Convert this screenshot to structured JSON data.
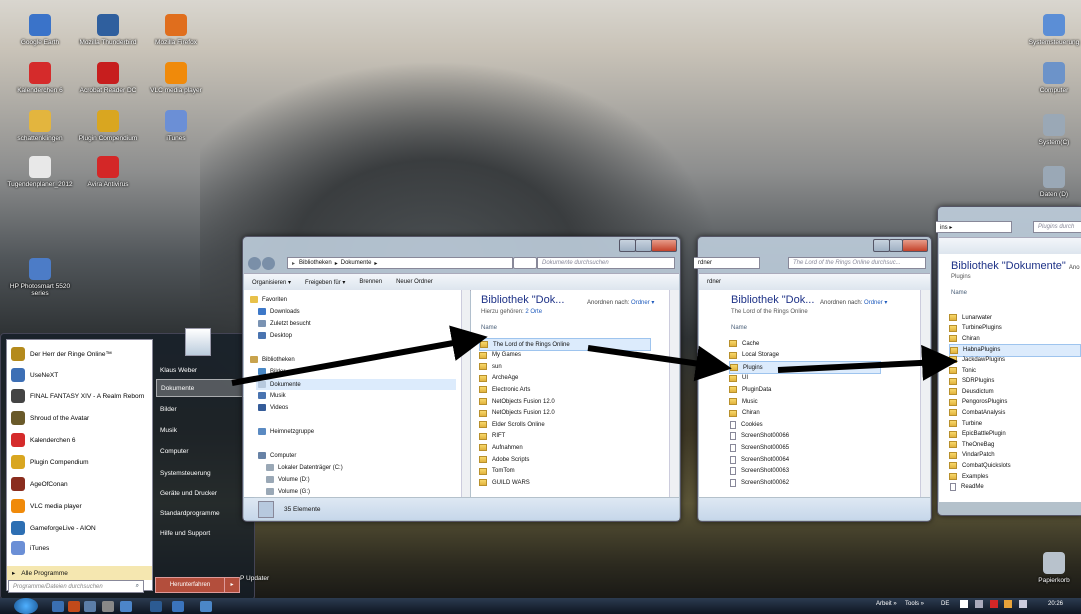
{
  "desktop_icons_left": [
    {
      "label": "Google Earth",
      "icon": "google-earth-icon",
      "color": "#3a73c9"
    },
    {
      "label": "Mozilla Thunderbird",
      "icon": "thunderbird-icon",
      "color": "#2f5f9e"
    },
    {
      "label": "Mozilla Firefox",
      "icon": "firefox-icon",
      "color": "#e06e1d"
    },
    {
      "label": "Kalenderchen 6",
      "icon": "calendar-icon",
      "color": "#d52b2b"
    },
    {
      "label": "Acrobat Reader DC",
      "icon": "acrobat-icon",
      "color": "#c71e1e"
    },
    {
      "label": "VLC media player",
      "icon": "vlc-icon",
      "color": "#f08a0a"
    },
    {
      "label": "schattenklingen",
      "icon": "folder-icon",
      "color": "#e3b53e"
    },
    {
      "label": "Plugin Compendium",
      "icon": "plugin-compendium-icon",
      "color": "#d9a620"
    },
    {
      "label": "iTunes",
      "icon": "itunes-icon",
      "color": "#6b8fd6"
    },
    {
      "label": "Tugendenplaner_2012",
      "icon": "document-icon",
      "color": "#e8e8e8"
    },
    {
      "label": "Avira Antivirus",
      "icon": "avira-icon",
      "color": "#d42727"
    },
    {
      "label": "HP Photosmart 5520 series",
      "icon": "printer-icon",
      "color": "#4c7cc7"
    }
  ],
  "desktop_icons_right": [
    {
      "label": "Systemsteuerung",
      "icon": "control-panel-icon",
      "color": "#5b8ed6"
    },
    {
      "label": "Computer",
      "icon": "computer-icon",
      "color": "#6c93c9"
    },
    {
      "label": "System(C)",
      "icon": "drive-icon",
      "color": "#9aa8b6"
    },
    {
      "label": "Daten (D)",
      "icon": "drive-icon",
      "color": "#9aa8b6"
    },
    {
      "label": "Papierkorb",
      "icon": "recycle-bin-icon",
      "color": "#b8c2cc"
    }
  ],
  "start_menu": {
    "programs": [
      {
        "label": "Der Herr der Ringe Online™",
        "color": "#b48a1c"
      },
      {
        "label": "UseNeXT",
        "color": "#3d6fb5"
      },
      {
        "label": "FINAL FANTASY XIV - A Realm Reborn",
        "color": "#444"
      },
      {
        "label": "Shroud of the Avatar",
        "color": "#6a5a2a"
      },
      {
        "label": "Kalenderchen 6",
        "color": "#d52b2b"
      },
      {
        "label": "Plugin Compendium",
        "color": "#d9a620"
      },
      {
        "label": "AgeOfConan",
        "color": "#8a2d1e"
      },
      {
        "label": "VLC media player",
        "color": "#f08a0a"
      },
      {
        "label": "GameforgeLive - AION",
        "color": "#2d6fb3"
      },
      {
        "label": "iTunes",
        "color": "#6b8fd6"
      }
    ],
    "all_programs": "Alle Programme",
    "search_placeholder": "Programme/Dateien durchsuchen",
    "right_items": [
      "Klaus Weber",
      "Dokumente",
      "Bilder",
      "Musik",
      "Computer",
      "Systemsteuerung",
      "Geräte und Drucker",
      "Standardprogramme",
      "Hilfe und Support"
    ],
    "shutdown": "Herunterfahren",
    "shutdown_arrow": "▸"
  },
  "window1": {
    "address": [
      "Bibliotheken",
      "Dokumente"
    ],
    "search_placeholder": "Dokumente durchsuchen",
    "toolbar": [
      "Organisieren ▾",
      "Freigeben für ▾",
      "Brennen",
      "Neuer Ordner"
    ],
    "nav": {
      "favorites": "Favoriten",
      "fav_items": [
        "Downloads",
        "Zuletzt besucht",
        "Desktop"
      ],
      "libraries": "Bibliotheken",
      "lib_items": [
        "Bilder",
        "Dokumente",
        "Musik",
        "Videos"
      ],
      "homegroup": "Heimnetzgruppe",
      "computer": "Computer",
      "drives": [
        "Lokaler Datenträger (C:)",
        "Volume (D:)",
        "Volume (G:)"
      ]
    },
    "lib_title": "Bibliothek \"Dok...",
    "lib_sub": "Hierzu gehören:",
    "lib_sub_link": "2 Orte",
    "arrange": "Anordnen nach:",
    "arrange_value": "Ordner ▾",
    "col_name": "Name",
    "files": [
      "The Lord of the Rings Online",
      "My Games",
      "sun",
      "ArcheAge",
      "Electronic Arts",
      "NetObjects Fusion 12.0",
      "NetObjects Fusion 12.0",
      "Elder Scrolls Online",
      "RIFT",
      "Aufnahmen",
      "Adobe Scripts",
      "TomTom",
      "GUILD WARS"
    ],
    "status": "35 Elemente"
  },
  "window2": {
    "address_fragment": "rdner",
    "search_placeholder": "The Lord of the Rings Online durchsuc...",
    "lib_title": "Bibliothek \"Dok...",
    "lib_sub": "The Lord of the Rings Online",
    "arrange": "Anordnen nach:",
    "arrange_value": "Ordner ▾",
    "col_name": "Name",
    "files": [
      {
        "name": "Cache",
        "type": "folder"
      },
      {
        "name": "Local Storage",
        "type": "folder"
      },
      {
        "name": "Plugins",
        "type": "folder"
      },
      {
        "name": "UI",
        "type": "folder"
      },
      {
        "name": "PluginData",
        "type": "folder"
      },
      {
        "name": "Music",
        "type": "folder"
      },
      {
        "name": "Chiran",
        "type": "folder"
      },
      {
        "name": "Cookies",
        "type": "file"
      },
      {
        "name": "ScreenShot00066",
        "type": "image"
      },
      {
        "name": "ScreenShot00065",
        "type": "image"
      },
      {
        "name": "ScreenShot00064",
        "type": "image"
      },
      {
        "name": "ScreenShot00063",
        "type": "image"
      },
      {
        "name": "ScreenShot00062",
        "type": "image"
      }
    ]
  },
  "window3": {
    "address_fragment": "ins ▸",
    "search_placeholder": "Plugins durch",
    "lib_title": "Bibliothek \"Dokumente\"",
    "lib_title_cut": "Ano",
    "lib_sub": "Plugins",
    "col_name": "Name",
    "files": [
      {
        "name": "Lunarwater",
        "type": "folder"
      },
      {
        "name": "TurbinePlugins",
        "type": "folder"
      },
      {
        "name": "Chiran",
        "type": "folder"
      },
      {
        "name": "HabnaPlugins",
        "type": "folder"
      },
      {
        "name": "JackdawPlugins",
        "type": "folder"
      },
      {
        "name": "Tonic",
        "type": "folder"
      },
      {
        "name": "SDRPlugins",
        "type": "folder"
      },
      {
        "name": "Deusdictum",
        "type": "folder"
      },
      {
        "name": "PengorosPlugins",
        "type": "folder"
      },
      {
        "name": "CombatAnalysis",
        "type": "folder"
      },
      {
        "name": "Turbine",
        "type": "folder"
      },
      {
        "name": "EpicBattlePlugin",
        "type": "folder"
      },
      {
        "name": "TheOneBag",
        "type": "folder"
      },
      {
        "name": "VindarPatch",
        "type": "folder"
      },
      {
        "name": "CombatQuickslots",
        "type": "folder"
      },
      {
        "name": "Examples",
        "type": "folder"
      },
      {
        "name": "ReadMe",
        "type": "file"
      }
    ]
  },
  "partial_label": "P Updater",
  "taskbar": {
    "toolbars": [
      "Arbeit »",
      "Tools »"
    ],
    "lang": "DE",
    "time": "20:26"
  }
}
